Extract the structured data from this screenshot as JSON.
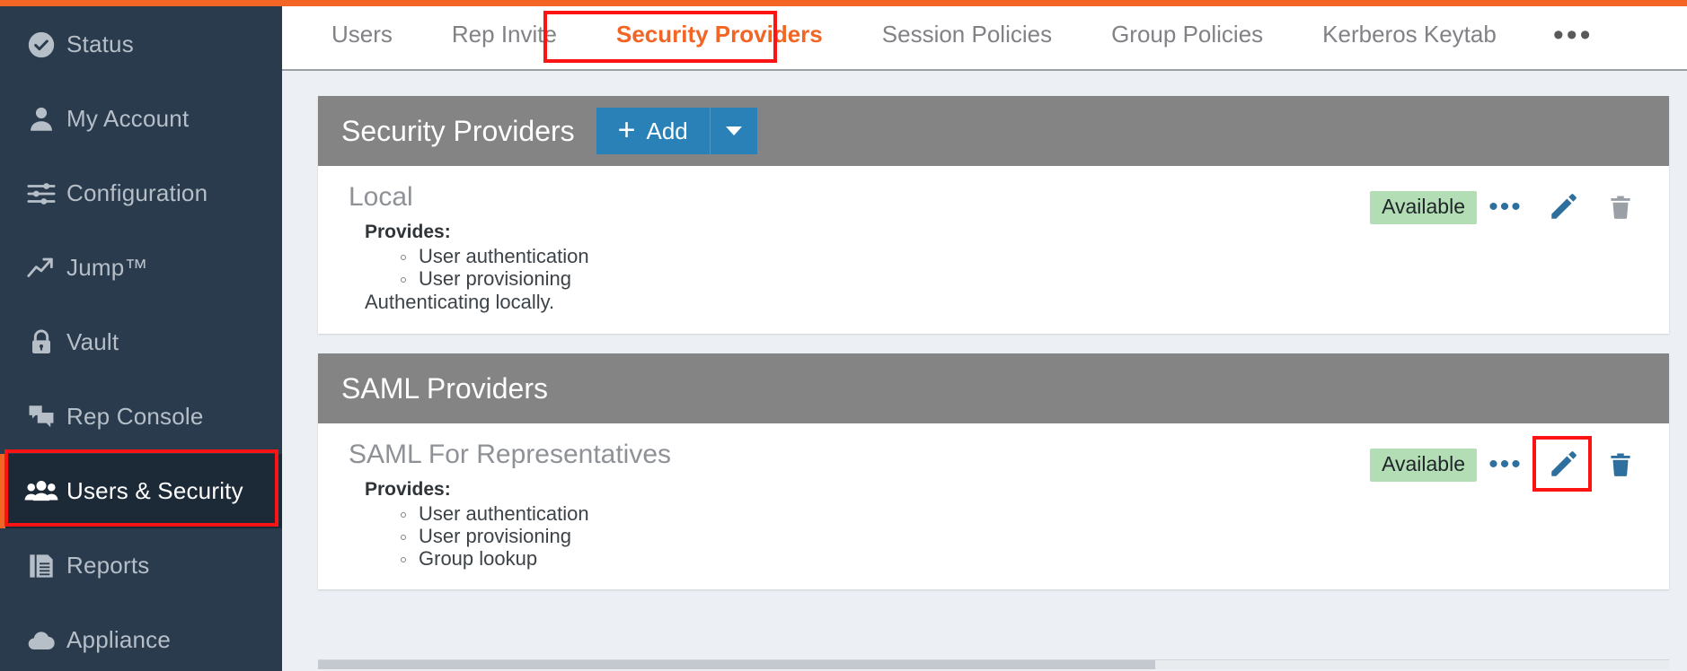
{
  "colors": {
    "accent_orange": "#f26524",
    "sidebar_bg": "#2a3b4d",
    "sidebar_active_bg": "#1c2937",
    "highlight_red": "#fc1414",
    "panel_header_gray": "#848484",
    "add_button_blue": "#2981b8",
    "badge_green": "#b3ddb4",
    "pencil_blue": "#2e6f9e"
  },
  "sidebar": {
    "items": [
      {
        "label": "Status",
        "icon": "check-circle-icon",
        "active": false
      },
      {
        "label": "My Account",
        "icon": "person-icon",
        "active": false
      },
      {
        "label": "Configuration",
        "icon": "sliders-icon",
        "active": false
      },
      {
        "label": "Jump™",
        "icon": "trend-arrow-icon",
        "active": false
      },
      {
        "label": "Vault",
        "icon": "lock-icon",
        "active": false
      },
      {
        "label": "Rep Console",
        "icon": "chat-bubbles-icon",
        "active": false
      },
      {
        "label": "Users & Security",
        "icon": "users-group-icon",
        "active": true
      },
      {
        "label": "Reports",
        "icon": "report-document-icon",
        "active": false
      },
      {
        "label": "Appliance",
        "icon": "cloud-icon",
        "active": false
      }
    ]
  },
  "tabs": {
    "items": [
      {
        "label": "Users",
        "active": false
      },
      {
        "label": "Rep Invite",
        "active": false
      },
      {
        "label": "Security Providers",
        "active": true
      },
      {
        "label": "Session Policies",
        "active": false
      },
      {
        "label": "Group Policies",
        "active": false
      },
      {
        "label": "Kerberos Keytab",
        "active": false
      }
    ],
    "overflow_label": "•••"
  },
  "panels": [
    {
      "title": "Security Providers",
      "has_add_button": true,
      "add_label": "Add",
      "add_plus": "+",
      "rows": [
        {
          "name": "Local",
          "provides_label": "Provides:",
          "provides": [
            "User authentication",
            "User provisioning"
          ],
          "note": "Authenticating locally.",
          "status": "Available",
          "dots_label": "•••",
          "pencil_highlighted": false,
          "trash_color": "#9aa0a6"
        }
      ]
    },
    {
      "title": "SAML Providers",
      "has_add_button": false,
      "rows": [
        {
          "name": "SAML For Representatives",
          "provides_label": "Provides:",
          "provides": [
            "User authentication",
            "User provisioning",
            "Group lookup"
          ],
          "note": "",
          "status": "Available",
          "dots_label": "•••",
          "pencil_highlighted": true,
          "trash_color": "#2e6f9e"
        }
      ]
    }
  ]
}
